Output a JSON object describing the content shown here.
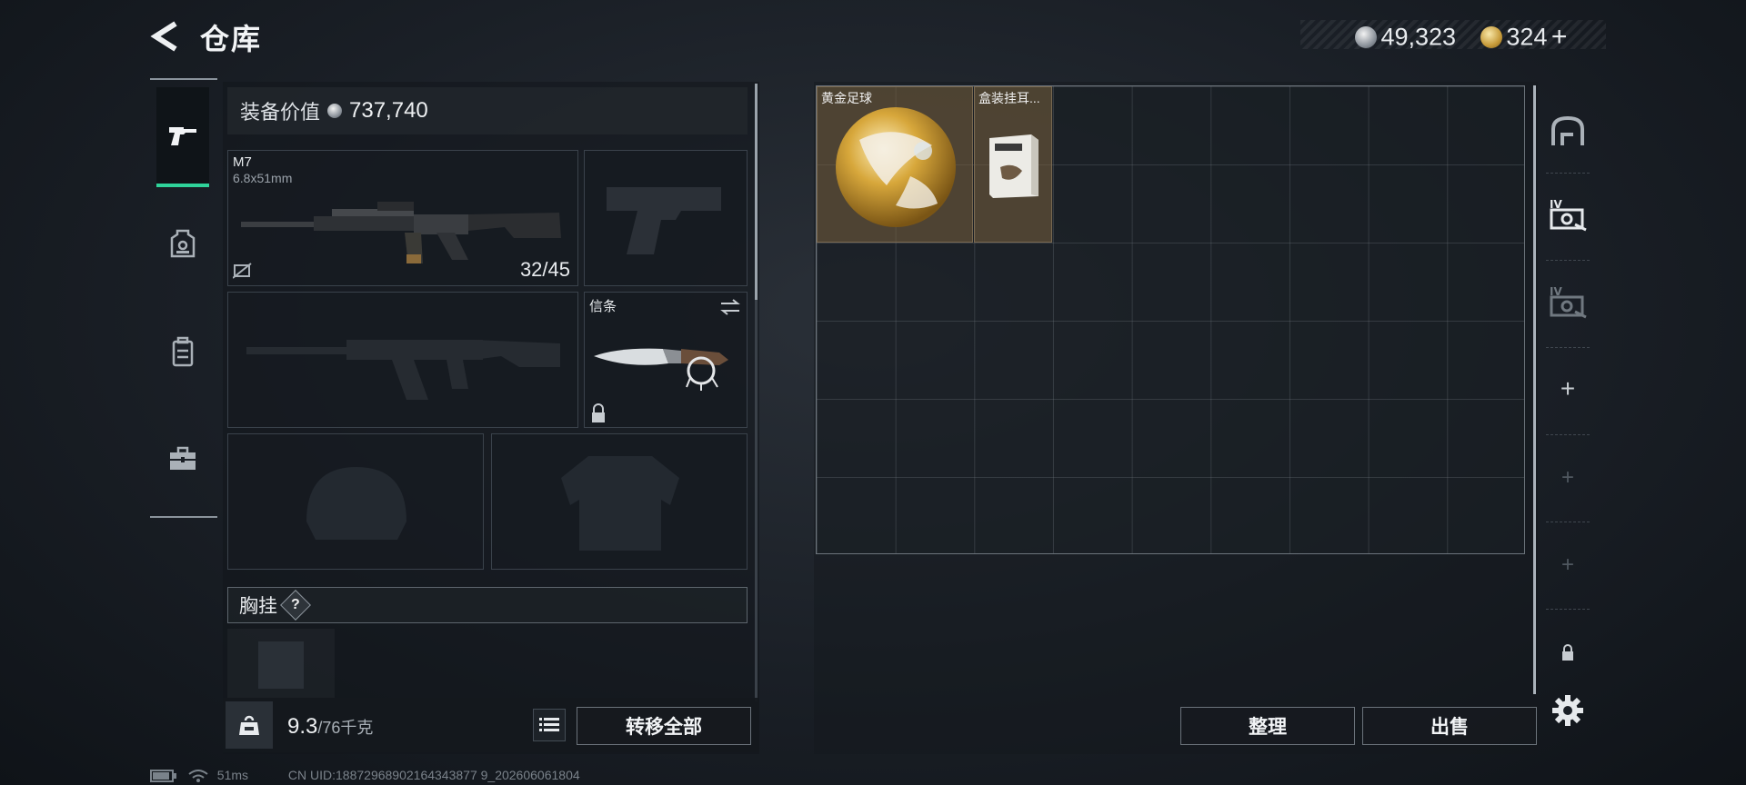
{
  "header": {
    "title": "仓库",
    "silver_amount": "49,323",
    "gold_amount": "324",
    "add_label": "+"
  },
  "left_tabs": [
    {
      "name": "weapons",
      "active": true
    },
    {
      "name": "armor",
      "active": false
    },
    {
      "name": "backpack",
      "active": false
    },
    {
      "name": "case",
      "active": false
    }
  ],
  "loadout": {
    "equip_value_label": "装备价值",
    "equip_value": "737,740",
    "primary": {
      "name": "M7",
      "caliber": "6.8x51mm",
      "ammo": "32/45"
    },
    "melee": {
      "label": "信条"
    },
    "chest_label": "胸挂",
    "chest_help": "?"
  },
  "bottom": {
    "weight_current": "9.3",
    "weight_max": "/76千克",
    "transfer_all": "转移全部",
    "organize": "整理",
    "sell": "出售"
  },
  "storage": {
    "items": [
      {
        "name": "黄金足球"
      },
      {
        "name": "盒装挂耳..."
      }
    ]
  },
  "status_bar": {
    "ping": "51ms",
    "uid": "CN UID:18872968902164343877 9_202606061804"
  },
  "colors": {
    "accent_green": "#2fd39a",
    "item_bg": "#78603e"
  }
}
